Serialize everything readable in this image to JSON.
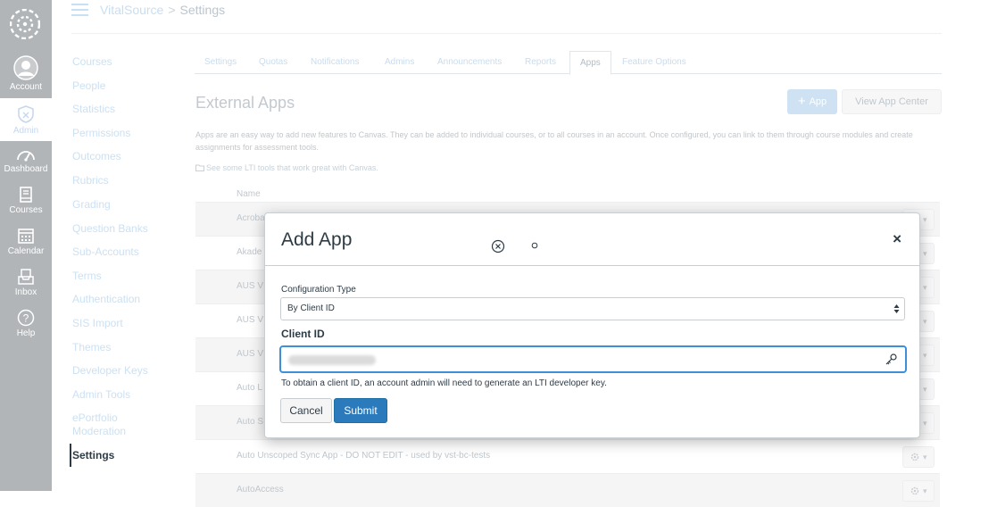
{
  "global_nav": {
    "items": [
      {
        "label": "Account",
        "icon": "user-circle-icon"
      },
      {
        "label": "Admin",
        "icon": "shield-icon"
      },
      {
        "label": "Dashboard",
        "icon": "dashboard-icon"
      },
      {
        "label": "Courses",
        "icon": "book-icon"
      },
      {
        "label": "Calendar",
        "icon": "calendar-icon"
      },
      {
        "label": "Inbox",
        "icon": "inbox-icon"
      },
      {
        "label": "Help",
        "icon": "help-icon"
      }
    ]
  },
  "header": {
    "breadcrumb_root": "VitalSource",
    "breadcrumb_separator": ">",
    "breadcrumb_current": "Settings"
  },
  "course_nav": {
    "items": [
      "Courses",
      "People",
      "Statistics",
      "Permissions",
      "Outcomes",
      "Rubrics",
      "Grading",
      "Question Banks",
      "Sub-Accounts",
      "Terms",
      "Authentication",
      "SIS Import",
      "Themes",
      "Developer Keys",
      "Admin Tools",
      "ePortfolio Moderation",
      "Settings"
    ],
    "active": "Settings"
  },
  "tabs": {
    "items": [
      "Settings",
      "Quotas",
      "Notifications",
      "Admins",
      "Announcements",
      "Reports",
      "Apps",
      "Feature Options"
    ],
    "active": "Apps"
  },
  "main": {
    "title": "External Apps",
    "add_app_label": "App",
    "view_app_center_label": "View App Center",
    "intro": "Apps are an easy way to add new features to Canvas. They can be added to individual courses, or to all courses in an account. Once configured, you can link to them through course modules and create assignments for assessment tools.",
    "lti_link": "See some LTI tools that work great with Canvas.",
    "name_header": "Name",
    "rows": [
      "Acroba",
      "Akade",
      "AUS V",
      "AUS V",
      "AUS V",
      "Auto L",
      "Auto S",
      "Auto Unscoped Sync App - DO NOT EDIT - used by vst-bc-tests",
      "AutoAccess"
    ]
  },
  "modal": {
    "title": "Add App",
    "close_glyph": "×",
    "config_type_label": "Configuration Type",
    "config_type_value": "By Client ID",
    "client_id_label": "Client ID",
    "client_id_value": "",
    "help_text": "To obtain a client ID, an account admin will need to generate an LTI developer key.",
    "cancel_label": "Cancel",
    "submit_label": "Submit"
  },
  "colors": {
    "nav_bg": "#b1b5b8",
    "primary": "#2b7abc",
    "focus": "#3f8ed8",
    "text": "#2d3b45"
  }
}
